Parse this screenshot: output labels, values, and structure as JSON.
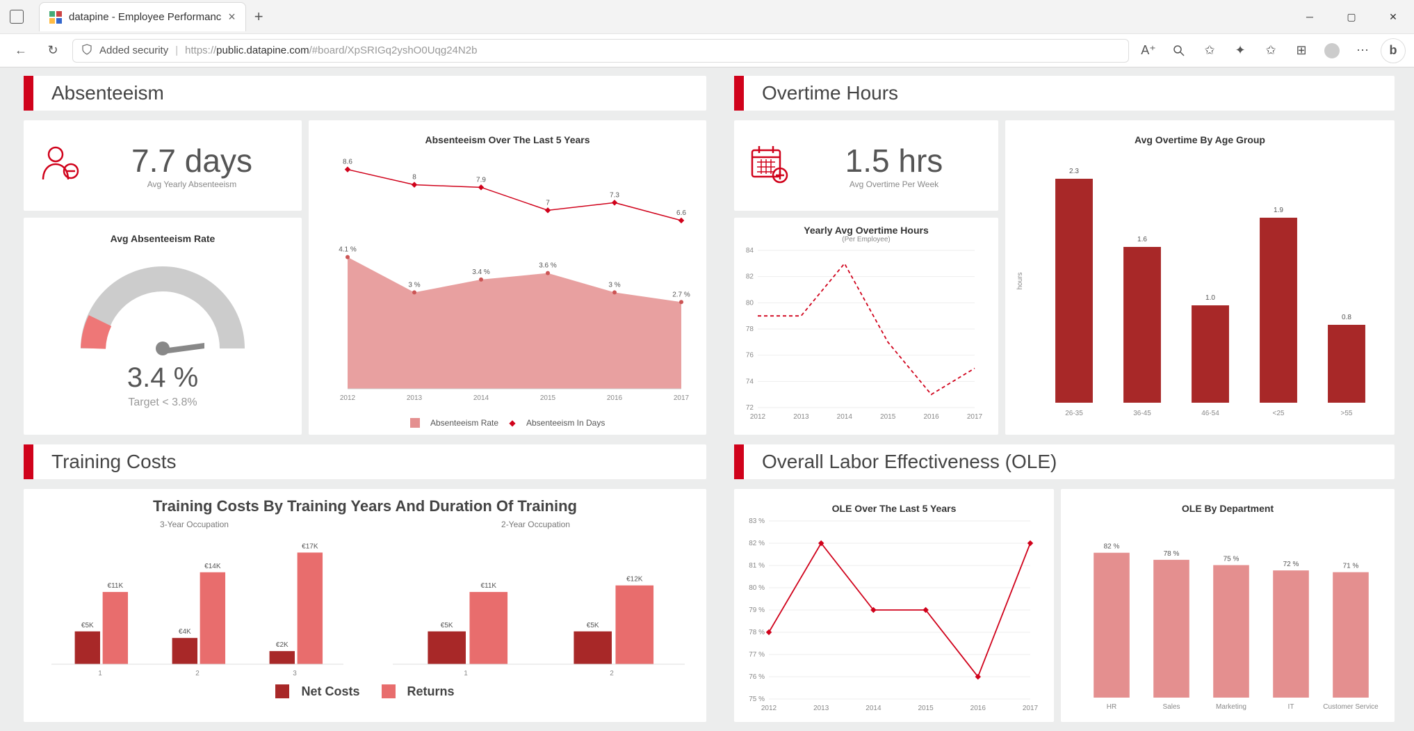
{
  "browser": {
    "tab_title": "datapine - Employee Performanc",
    "security_label": "Added security",
    "url_prefix": "https://",
    "url_host": "public.datapine.com",
    "url_path": "/#board/XpSRIGq2yshO0Uqg24N2b"
  },
  "absenteeism": {
    "title": "Absenteeism",
    "kpi_value": "7.7 days",
    "kpi_label": "Avg Yearly Absenteeism",
    "gauge_title": "Avg Absenteeism Rate",
    "gauge_value": "3.4 %",
    "gauge_target": "Target < 3.8%",
    "chart_title": "Absenteeism Over The Last 5 Years",
    "legend_rate": "Absenteeism Rate",
    "legend_days": "Absenteeism In Days"
  },
  "overtime": {
    "title": "Overtime Hours",
    "kpi_value": "1.5 hrs",
    "kpi_label": "Avg Overtime Per Week",
    "yearly_title": "Yearly Avg Overtime Hours",
    "yearly_sub": "(Per Employee)",
    "age_title": "Avg Overtime By Age Group",
    "age_ylabel": "hours"
  },
  "training": {
    "title": "Training Costs",
    "chart_title": "Training Costs By Training Years And Duration Of Training",
    "sub_3y": "3-Year Occupation",
    "sub_2y": "2-Year Occupation",
    "legend_net": "Net Costs",
    "legend_ret": "Returns"
  },
  "ole": {
    "title": "Overall Labor Effectiveness (OLE)",
    "chart5y_title": "OLE Over The Last 5 Years",
    "dept_title": "OLE By Department"
  },
  "chart_data": [
    {
      "id": "absenteeism_5y",
      "type": "line+area",
      "title": "Absenteeism Over The Last 5 Years",
      "categories": [
        "2012",
        "2013",
        "2014",
        "2015",
        "2016",
        "2017"
      ],
      "series": [
        {
          "name": "Absenteeism In Days",
          "type": "line",
          "values": [
            8.6,
            8.0,
            7.9,
            7.0,
            7.3,
            6.6
          ]
        },
        {
          "name": "Absenteeism Rate",
          "type": "area",
          "unit": "%",
          "values": [
            4.1,
            3.0,
            3.4,
            3.6,
            3.0,
            2.7
          ]
        }
      ]
    },
    {
      "id": "absenteeism_gauge",
      "type": "gauge",
      "value": 3.4,
      "unit": "%",
      "target": 3.8,
      "range": [
        0,
        10
      ]
    },
    {
      "id": "overtime_yearly",
      "type": "line",
      "title": "Yearly Avg Overtime Hours",
      "subtitle": "(Per Employee)",
      "categories": [
        "2012",
        "2013",
        "2014",
        "2015",
        "2016",
        "2017"
      ],
      "values": [
        79,
        79,
        83,
        77,
        73,
        75
      ],
      "ylim": [
        72,
        84
      ]
    },
    {
      "id": "overtime_age",
      "type": "bar",
      "title": "Avg Overtime By Age Group",
      "ylabel": "hours",
      "categories": [
        "26-35",
        "36-45",
        "46-54",
        "<25",
        ">55"
      ],
      "values": [
        2.3,
        1.6,
        1.0,
        1.9,
        0.8
      ],
      "ylim": [
        0,
        2.5
      ]
    },
    {
      "id": "training_3y",
      "type": "bar",
      "title": "3-Year Occupation",
      "categories": [
        "1",
        "2",
        "3"
      ],
      "series": [
        {
          "name": "Net Costs",
          "values": [
            5,
            4,
            2
          ],
          "labels": [
            "€5K",
            "€4K",
            "€2K"
          ]
        },
        {
          "name": "Returns",
          "values": [
            11,
            14,
            17
          ],
          "labels": [
            "€11K",
            "€14K",
            "€17K"
          ]
        }
      ],
      "ylim": [
        0,
        18
      ]
    },
    {
      "id": "training_2y",
      "type": "bar",
      "title": "2-Year Occupation",
      "categories": [
        "1",
        "2"
      ],
      "series": [
        {
          "name": "Net Costs",
          "values": [
            5,
            5
          ],
          "labels": [
            "€5K",
            "€5K"
          ]
        },
        {
          "name": "Returns",
          "values": [
            11,
            12
          ],
          "labels": [
            "€11K",
            "€12K"
          ]
        }
      ],
      "ylim": [
        0,
        18
      ]
    },
    {
      "id": "ole_5y",
      "type": "line",
      "title": "OLE Over The Last 5 Years",
      "categories": [
        "2012",
        "2013",
        "2014",
        "2015",
        "2016",
        "2017"
      ],
      "values": [
        78,
        82,
        79,
        79,
        76,
        82
      ],
      "unit": "%",
      "ylim": [
        75,
        83
      ]
    },
    {
      "id": "ole_dept",
      "type": "bar",
      "title": "OLE By Department",
      "categories": [
        "HR",
        "Sales",
        "Marketing",
        "IT",
        "Customer Service"
      ],
      "values": [
        82,
        78,
        75,
        72,
        71
      ],
      "unit": "%",
      "ylim": [
        0,
        100
      ]
    }
  ]
}
